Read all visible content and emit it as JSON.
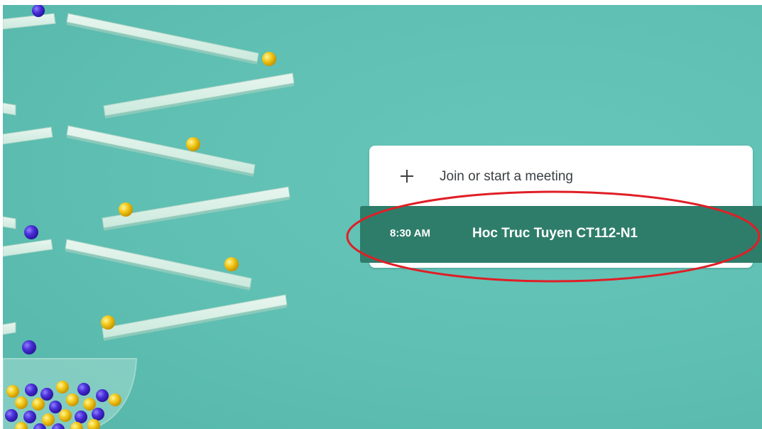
{
  "join": {
    "icon": "plus-icon",
    "label": "Join or start a meeting"
  },
  "meeting": {
    "time": "8:30 AM",
    "title": "Hoc Truc Tuyen CT112-N1"
  },
  "colors": {
    "background": "#5ebfb2",
    "meeting_highlight": "#2e7d6a",
    "annotation_ring": "#e01e26",
    "text_primary": "#3c4043"
  }
}
